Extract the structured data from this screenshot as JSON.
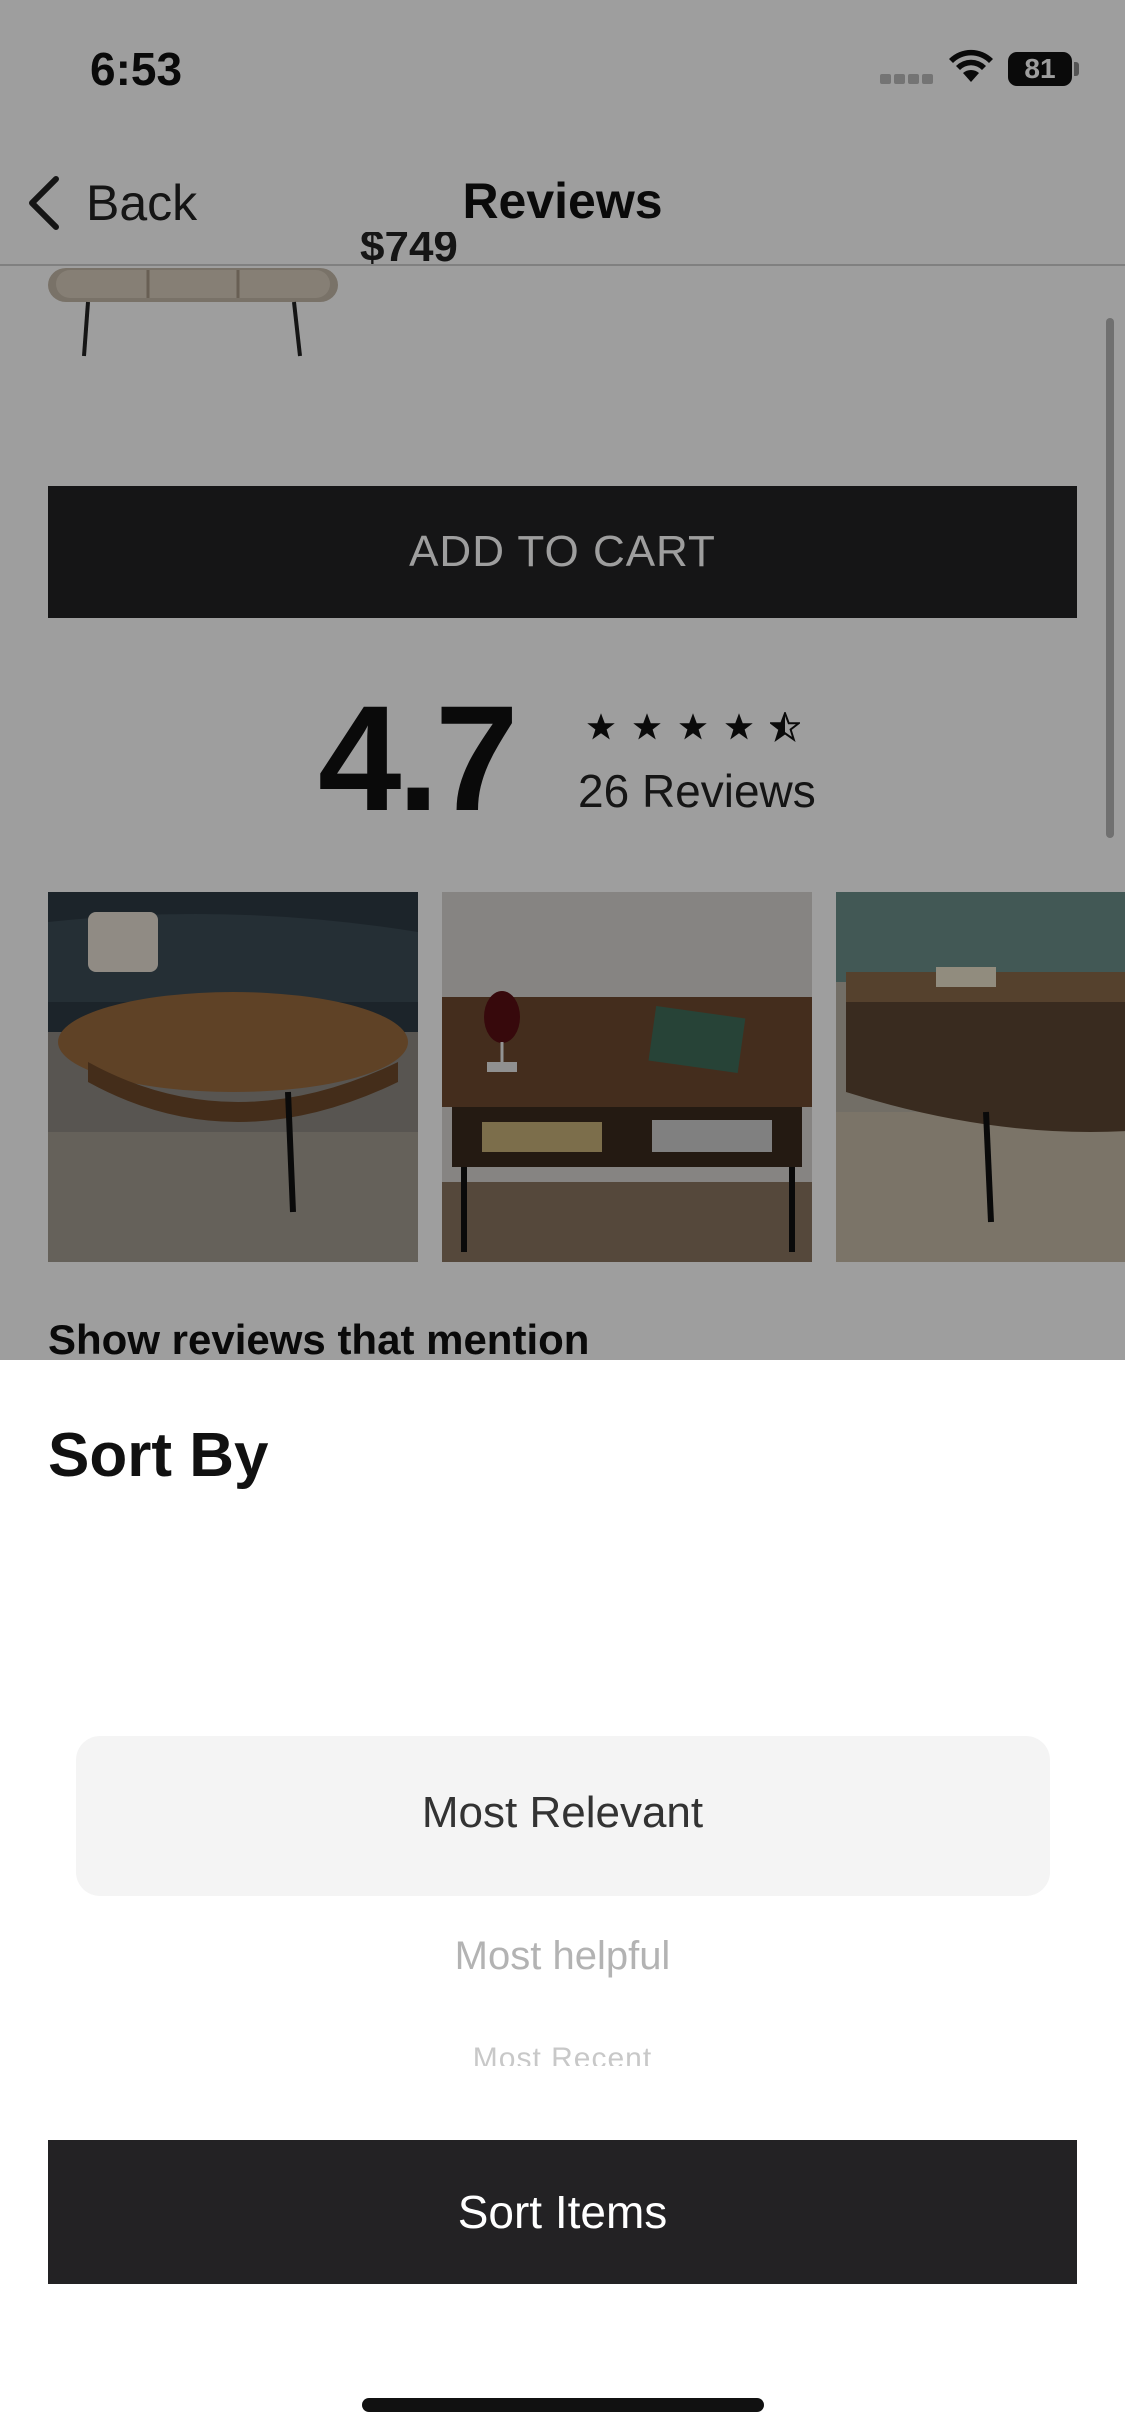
{
  "status_bar": {
    "time": "6:53",
    "battery": "81"
  },
  "nav": {
    "back_label": "Back",
    "title": "Reviews"
  },
  "product": {
    "price_partial": "$749"
  },
  "add_to_cart_label": "ADD TO CART",
  "rating": {
    "value": "4.7",
    "stars": 4.5,
    "count_label": "26 Reviews"
  },
  "photos_section": {
    "heading": "Show reviews that mention"
  },
  "sort_sheet": {
    "title": "Sort By",
    "options": [
      "Most Relevant",
      "Most helpful",
      "Most Recent"
    ],
    "selected": "Most Relevant",
    "button_label": "Sort Items"
  },
  "colors": {
    "button": "#232224",
    "overlay": "rgba(0,0,0,0.38)",
    "picker_highlight": "#f4f4f4"
  }
}
